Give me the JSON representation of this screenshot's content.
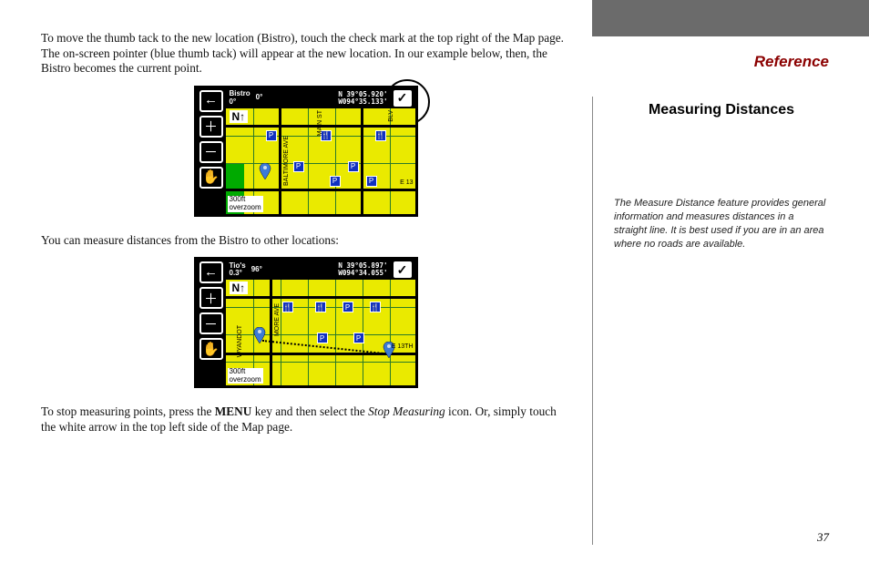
{
  "left": {
    "para1_a": "To move the thumb tack to the new location (Bistro), touch the check mark at the top right of the Map page. The on-screen pointer (blue thumb tack) will appear at the new location. In our example below, then, the Bistro becomes the current point.",
    "para2": "You can measure distances from the Bistro to other locations:",
    "para3_a": "To stop measuring points, press the ",
    "para3_menu": "MENU",
    "para3_b": " key and then select the ",
    "para3_stop": "Stop Measuring",
    "para3_c": " icon. Or, simply touch the white arrow in the top left side of the Map page."
  },
  "fig1": {
    "loc_name": "Bistro",
    "loc_dist": "0°",
    "bearing": "0°",
    "coord_n": "N  39°05.920'",
    "coord_w": "W094°35.133'",
    "north": "N↑",
    "scale_top": "300ft",
    "scale_bot": "overzoom",
    "street_v1": "BALTIMORE AVE",
    "street_v2": "MAIN ST",
    "street_v3": "BLV",
    "street_h1": "E 13"
  },
  "fig2": {
    "loc_name": "Tio's",
    "loc_dist": "0.3°",
    "bearing": "96°",
    "coord_n": "N  39°05.897'",
    "coord_w": "W094°34.055'",
    "north": "N↑",
    "scale_top": "300ft",
    "scale_bot": "overzoom",
    "street_v1": "WYANDOT",
    "street_v2": "MORE AVE",
    "street_h1": "E 13TH"
  },
  "right": {
    "ref": "Reference",
    "sub": "Measuring Distances",
    "note": "The Measure Distance feature provides general information and measures distances in a straight line. It is best used if you are in an area where no roads are available.",
    "page": "37"
  },
  "icons": {
    "back": "←",
    "zoom_in": "＋",
    "zoom_out": "－",
    "hand": "✋",
    "check": "✓",
    "poi_p": "P",
    "poi_r": "🍴"
  }
}
